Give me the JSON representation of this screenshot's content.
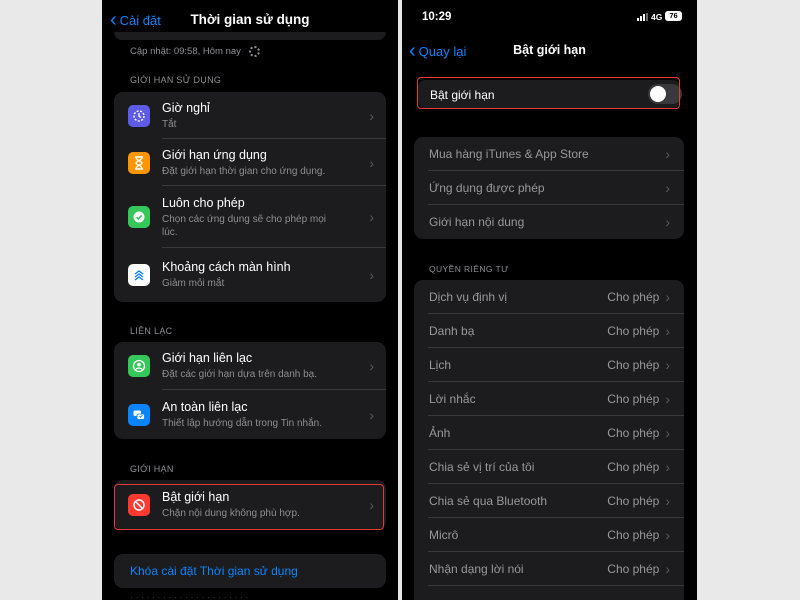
{
  "left": {
    "back_label": "Cài đặt",
    "title": "Thời gian sử dụng",
    "updated": "Cập nhật: 09:58, Hôm nay",
    "sections": [
      {
        "header": "GIỚI HẠN SỬ DỤNG",
        "items": [
          {
            "icon": "moon-clock-icon",
            "color": "#5e5ce6",
            "title": "Giờ nghỉ",
            "subtitle": "Tắt"
          },
          {
            "icon": "hourglass-icon",
            "color": "#ff9500",
            "title": "Giới hạn ứng dụng",
            "subtitle": "Đặt giới hạn thời gian cho ứng dụng."
          },
          {
            "icon": "checkmark-icon",
            "color": "#34c759",
            "title": "Luôn cho phép",
            "subtitle": "Chọn các ứng dụng sẽ cho phép mọi lúc."
          },
          {
            "icon": "chevrons-up-icon",
            "color": "#ffffff",
            "title": "Khoảng cách màn hình",
            "subtitle": "Giảm mỏi mắt"
          }
        ]
      },
      {
        "header": "LIÊN LẠC",
        "items": [
          {
            "icon": "person-circle-icon",
            "color": "#34c759",
            "title": "Giới hạn liên lạc",
            "subtitle": "Đặt các giới hạn dựa trên danh bạ."
          },
          {
            "icon": "chat-bubbles-icon",
            "color": "#0a84ff",
            "title": "An toàn liên lạc",
            "subtitle": "Thiết lập hướng dẫn trong Tin nhắn."
          }
        ]
      },
      {
        "header": "GIỚI HẠN",
        "items": [
          {
            "icon": "no-entry-icon",
            "color": "#ff3b30",
            "title": "Bật giới hạn",
            "subtitle": "Chặn nội dung không phù hợp."
          }
        ]
      }
    ],
    "lock_link": "Khóa cài đặt Thời gian sử dụng"
  },
  "right": {
    "status": {
      "time": "10:29",
      "network": "4G",
      "battery": "76"
    },
    "back_label": "Quay lại",
    "title": "Bật giới hạn",
    "toggle": {
      "label": "Bật giới hạn",
      "on": false
    },
    "group1": [
      "Mua hàng iTunes & App Store",
      "Ứng dụng được phép",
      "Giới hạn nội dung"
    ],
    "privacy_header": "QUYỀN RIÊNG TƯ",
    "privacy": [
      {
        "label": "Dịch vụ định vị",
        "value": "Cho phép"
      },
      {
        "label": "Danh bạ",
        "value": "Cho phép"
      },
      {
        "label": "Lịch",
        "value": "Cho phép"
      },
      {
        "label": "Lời nhắc",
        "value": "Cho phép"
      },
      {
        "label": "Ảnh",
        "value": "Cho phép"
      },
      {
        "label": "Chia sẻ vị trí của tôi",
        "value": "Cho phép"
      },
      {
        "label": "Chia sẻ qua Bluetooth",
        "value": "Cho phép"
      },
      {
        "label": "Micrô",
        "value": "Cho phép"
      },
      {
        "label": "Nhận dạng lời nói",
        "value": "Cho phép"
      }
    ]
  }
}
